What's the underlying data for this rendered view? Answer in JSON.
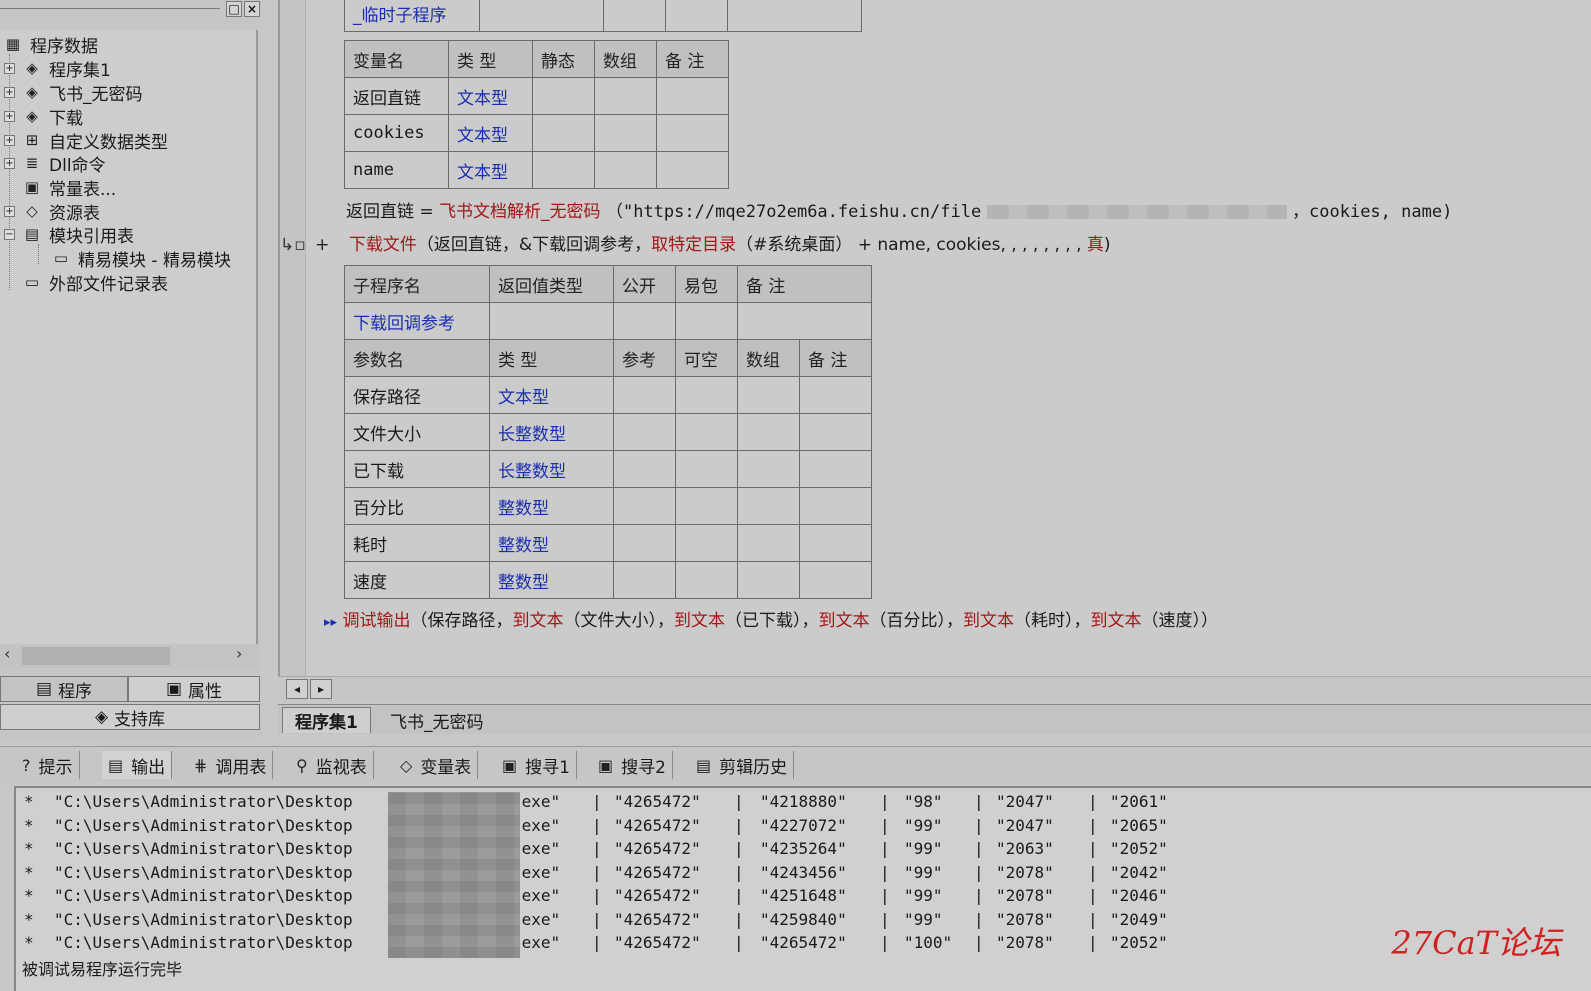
{
  "left_panel": {
    "tree": [
      {
        "label": "程序数据",
        "icon": "program-data-icon",
        "glyph": "▦",
        "expand": ""
      },
      {
        "label": "程序集1",
        "icon": "assembly-icon",
        "glyph": "◈",
        "expand": "+"
      },
      {
        "label": "飞书_无密码",
        "icon": "assembly-icon",
        "glyph": "◈",
        "expand": "+"
      },
      {
        "label": "下载",
        "icon": "assembly-icon",
        "glyph": "◈",
        "expand": "+"
      },
      {
        "label": "自定义数据类型",
        "icon": "custom-type-icon",
        "glyph": "⊞",
        "expand": "+"
      },
      {
        "label": "Dll命令",
        "icon": "dll-command-icon",
        "glyph": "≣",
        "expand": "+"
      },
      {
        "label": "常量表...",
        "icon": "constant-table-icon",
        "glyph": "▣",
        "expand": ""
      },
      {
        "label": "资源表",
        "icon": "resource-table-icon",
        "glyph": "◇",
        "expand": "+"
      },
      {
        "label": "模块引用表",
        "icon": "module-ref-icon",
        "glyph": "▤",
        "expand": "−"
      },
      {
        "label": "精易模块 - 精易模块",
        "icon": "module-file-icon",
        "glyph": "▭",
        "expand": ""
      },
      {
        "label": "外部文件记录表",
        "icon": "external-file-icon",
        "glyph": "▭",
        "expand": ""
      }
    ],
    "tabs": {
      "program": "程序",
      "properties": "属性",
      "support_lib": "支持库"
    }
  },
  "editor": {
    "temp_sub_label": "_临时子程序",
    "var_table": {
      "headers": [
        "变量名",
        "类 型",
        "静态",
        "数组",
        "备 注"
      ],
      "rows": [
        [
          "返回直链",
          "文本型"
        ],
        [
          "cookies",
          "文本型"
        ],
        [
          "name",
          "文本型"
        ]
      ]
    },
    "line1": {
      "lhs": "返回直链",
      "op": "=",
      "func": "飞书文档解析_无密码",
      "open": "（",
      "url": "\"https://mqe27o2em6a.feishu.cn/file",
      "rest": "，cookies, name)"
    },
    "line2": {
      "marker": "+",
      "func": "下载文件",
      "arg1": "（返回直链，&下载回调参考，",
      "func2": "取特定目录",
      "arg2": "（#系统桌面） + name, cookies, , , , , , , ,",
      "true_val": "真",
      "close": ")"
    },
    "sub_table": {
      "headers": [
        "子程序名",
        "返回值类型",
        "公开",
        "易包",
        "备 注"
      ],
      "name": "下载回调参考",
      "param_headers": [
        "参数名",
        "类 型",
        "参考",
        "可空",
        "数组",
        "备 注"
      ],
      "params": [
        [
          "保存路径",
          "文本型"
        ],
        [
          "文件大小",
          "长整数型"
        ],
        [
          "已下载",
          "长整数型"
        ],
        [
          "百分比",
          "整数型"
        ],
        [
          "耗时",
          "整数型"
        ],
        [
          "速度",
          "整数型"
        ]
      ]
    },
    "line3": {
      "func": "调试输出",
      "p1": "（保存路径，",
      "t1": "到文本",
      "p2": "（文件大小），",
      "t2": "到文本",
      "p3": "（已下载），",
      "t3": "到文本",
      "p4": "（百分比），",
      "t4": "到文本",
      "p5": "（耗时），",
      "t5": "到文本",
      "p6": "（速度））"
    }
  },
  "file_tabs": [
    "程序集1",
    "飞书_无密码"
  ],
  "bottom_tabs": [
    {
      "label": "提示",
      "icon": "hint-icon",
      "glyph": "?"
    },
    {
      "label": "输出",
      "icon": "output-icon",
      "glyph": "▤"
    },
    {
      "label": "调用表",
      "icon": "call-table-icon",
      "glyph": "⋕"
    },
    {
      "label": "监视表",
      "icon": "watch-icon",
      "glyph": "⚲"
    },
    {
      "label": "变量表",
      "icon": "variable-table-icon",
      "glyph": "◇"
    },
    {
      "label": "搜寻1",
      "icon": "search1-icon",
      "glyph": "▣"
    },
    {
      "label": "搜寻2",
      "icon": "search2-icon",
      "glyph": "▣"
    },
    {
      "label": "剪辑历史",
      "icon": "clip-history-icon",
      "glyph": "▤"
    }
  ],
  "output": {
    "rows": [
      [
        "*",
        "\"C:\\Users\\Administrator\\Desktop",
        ".exe\"",
        "|",
        "\"4265472\"",
        "|",
        "\"4218880\"",
        "|",
        "\"98\"",
        "|",
        "\"2047\"",
        "|",
        "\"2061\""
      ],
      [
        "*",
        "\"C:\\Users\\Administrator\\Desktop",
        ".exe\"",
        "|",
        "\"4265472\"",
        "|",
        "\"4227072\"",
        "|",
        "\"99\"",
        "|",
        "\"2047\"",
        "|",
        "\"2065\""
      ],
      [
        "*",
        "\"C:\\Users\\Administrator\\Desktop",
        ".exe\"",
        "|",
        "\"4265472\"",
        "|",
        "\"4235264\"",
        "|",
        "\"99\"",
        "|",
        "\"2063\"",
        "|",
        "\"2052\""
      ],
      [
        "*",
        "\"C:\\Users\\Administrator\\Desktop",
        ".exe\"",
        "|",
        "\"4265472\"",
        "|",
        "\"4243456\"",
        "|",
        "\"99\"",
        "|",
        "\"2078\"",
        "|",
        "\"2042\""
      ],
      [
        "*",
        "\"C:\\Users\\Administrator\\Desktop",
        ".exe\"",
        "|",
        "\"4265472\"",
        "|",
        "\"4251648\"",
        "|",
        "\"99\"",
        "|",
        "\"2078\"",
        "|",
        "\"2046\""
      ],
      [
        "*",
        "\"C:\\Users\\Administrator\\Desktop",
        ".exe\"",
        "|",
        "\"4265472\"",
        "|",
        "\"4259840\"",
        "|",
        "\"99\"",
        "|",
        "\"2078\"",
        "|",
        "\"2049\""
      ],
      [
        "*",
        "\"C:\\Users\\Administrator\\Desktop",
        ".exe\"",
        "|",
        "\"4265472\"",
        "|",
        "\"4265472\"",
        "|",
        "\"100\"",
        "|",
        "\"2078\"",
        "|",
        "\"2052\""
      ]
    ],
    "finish": "被调试易程序运行完毕"
  },
  "watermark": "27CaT论坛",
  "colors": {
    "keyword_red": "#a01818",
    "type_blue": "#1a2fb0",
    "bg": "#c8c8c8"
  }
}
